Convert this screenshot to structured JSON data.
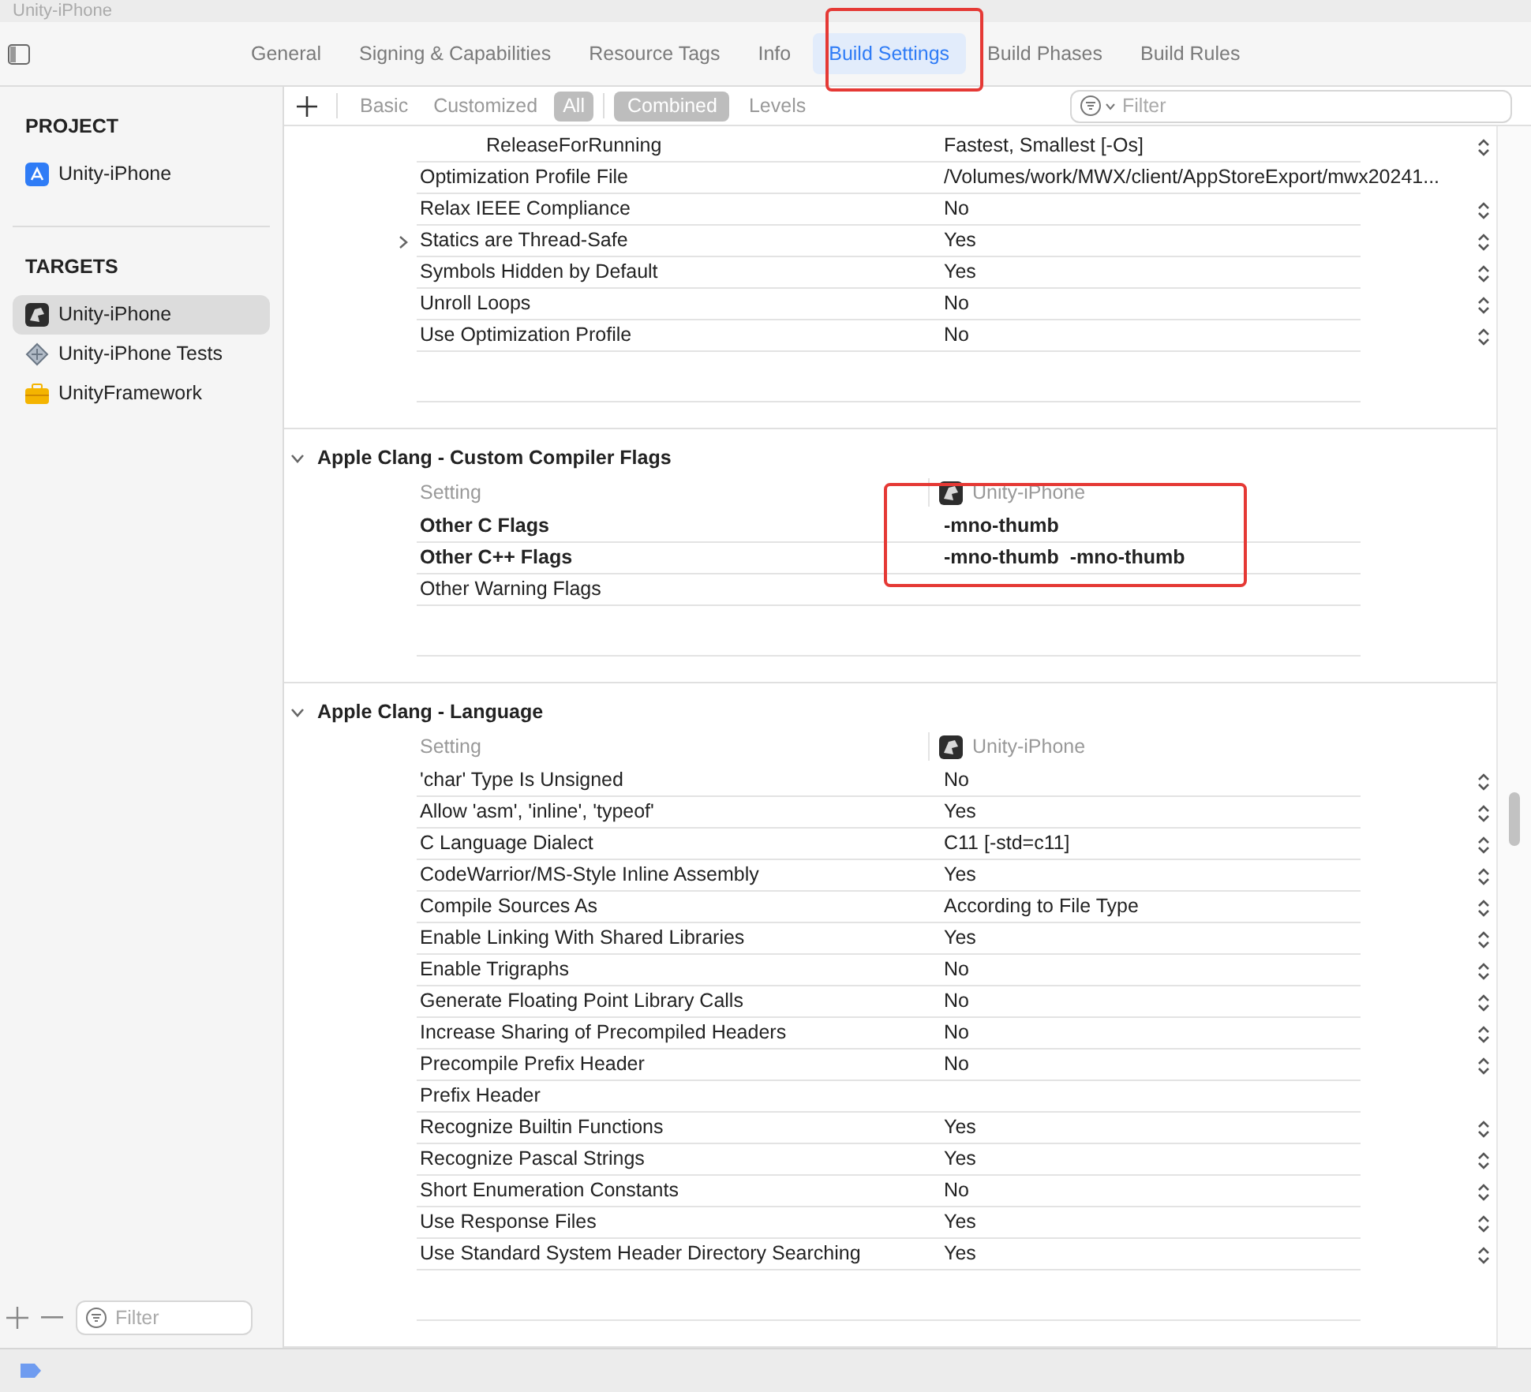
{
  "window": {
    "title": "Unity-iPhone"
  },
  "tabs": [
    {
      "label": "General",
      "selected": false
    },
    {
      "label": "Signing & Capabilities",
      "selected": false
    },
    {
      "label": "Resource Tags",
      "selected": false
    },
    {
      "label": "Info",
      "selected": false
    },
    {
      "label": "Build Settings",
      "selected": true
    },
    {
      "label": "Build Phases",
      "selected": false
    },
    {
      "label": "Build Rules",
      "selected": false
    }
  ],
  "sidebar": {
    "sections": [
      {
        "title": "PROJECT",
        "items": [
          {
            "label": "Unity-iPhone",
            "kind": "project",
            "selected": false
          }
        ]
      },
      {
        "title": "TARGETS",
        "items": [
          {
            "label": "Unity-iPhone",
            "kind": "app",
            "selected": true
          },
          {
            "label": "Unity-iPhone Tests",
            "kind": "tests",
            "selected": false
          },
          {
            "label": "UnityFramework",
            "kind": "framework",
            "selected": false
          }
        ]
      }
    ],
    "filter": {
      "placeholder": "Filter"
    }
  },
  "toolbar": {
    "scopes": [
      {
        "label": "Basic",
        "selected": false
      },
      {
        "label": "Customized",
        "selected": false
      },
      {
        "label": "All",
        "selected": true
      }
    ],
    "views": [
      {
        "label": "Combined",
        "selected": true
      },
      {
        "label": "Levels",
        "selected": false
      }
    ],
    "filter": {
      "placeholder": "Filter"
    }
  },
  "sections": [
    {
      "rows": [
        {
          "setting": "ReleaseForRunning",
          "value": "Fastest, Smallest [-Os]",
          "sub": true,
          "popup": true,
          "bold": false,
          "expandable": false
        },
        {
          "setting": "Optimization Profile File",
          "value": "/Volumes/work/MWX/client/AppStoreExport/mwx20241...",
          "sub": false,
          "popup": false,
          "bold": false,
          "expandable": false
        },
        {
          "setting": "Relax IEEE Compliance",
          "value": "No",
          "sub": false,
          "popup": true,
          "bold": false,
          "expandable": false
        },
        {
          "setting": "Statics are Thread-Safe",
          "value": "Yes",
          "sub": false,
          "popup": true,
          "bold": false,
          "expandable": true
        },
        {
          "setting": "Symbols Hidden by Default",
          "value": "Yes",
          "sub": false,
          "popup": true,
          "bold": false,
          "expandable": false
        },
        {
          "setting": "Unroll Loops",
          "value": "No",
          "sub": false,
          "popup": true,
          "bold": false,
          "expandable": false
        },
        {
          "setting": "Use Optimization Profile",
          "value": "No",
          "sub": false,
          "popup": true,
          "bold": false,
          "expandable": false
        }
      ]
    },
    {
      "title": "Apple Clang - Custom Compiler Flags",
      "expanded": true,
      "column_setting": "Setting",
      "column_target": "Unity-iPhone",
      "rows": [
        {
          "setting": "Other C Flags",
          "value": "-mno-thumb",
          "sub": false,
          "popup": false,
          "bold": true,
          "expandable": false
        },
        {
          "setting": "Other C++ Flags",
          "value": "-mno-thumb  -mno-thumb",
          "sub": false,
          "popup": false,
          "bold": true,
          "expandable": false
        },
        {
          "setting": "Other Warning Flags",
          "value": "",
          "sub": false,
          "popup": false,
          "bold": false,
          "expandable": false
        }
      ]
    },
    {
      "title": "Apple Clang - Language",
      "expanded": true,
      "column_setting": "Setting",
      "column_target": "Unity-iPhone",
      "rows": [
        {
          "setting": "'char' Type Is Unsigned",
          "value": "No",
          "sub": false,
          "popup": true,
          "bold": false,
          "expandable": false
        },
        {
          "setting": "Allow 'asm', 'inline', 'typeof'",
          "value": "Yes",
          "sub": false,
          "popup": true,
          "bold": false,
          "expandable": false
        },
        {
          "setting": "C Language Dialect",
          "value": "C11 [-std=c11]",
          "sub": false,
          "popup": true,
          "bold": false,
          "expandable": false
        },
        {
          "setting": "CodeWarrior/MS-Style Inline Assembly",
          "value": "Yes",
          "sub": false,
          "popup": true,
          "bold": false,
          "expandable": false
        },
        {
          "setting": "Compile Sources As",
          "value": "According to File Type",
          "sub": false,
          "popup": true,
          "bold": false,
          "expandable": false
        },
        {
          "setting": "Enable Linking With Shared Libraries",
          "value": "Yes",
          "sub": false,
          "popup": true,
          "bold": false,
          "expandable": false
        },
        {
          "setting": "Enable Trigraphs",
          "value": "No",
          "sub": false,
          "popup": true,
          "bold": false,
          "expandable": false
        },
        {
          "setting": "Generate Floating Point Library Calls",
          "value": "No",
          "sub": false,
          "popup": true,
          "bold": false,
          "expandable": false
        },
        {
          "setting": "Increase Sharing of Precompiled Headers",
          "value": "No",
          "sub": false,
          "popup": true,
          "bold": false,
          "expandable": false
        },
        {
          "setting": "Precompile Prefix Header",
          "value": "No",
          "sub": false,
          "popup": true,
          "bold": false,
          "expandable": false
        },
        {
          "setting": "Prefix Header",
          "value": "",
          "sub": false,
          "popup": false,
          "bold": false,
          "expandable": false
        },
        {
          "setting": "Recognize Builtin Functions",
          "value": "Yes",
          "sub": false,
          "popup": true,
          "bold": false,
          "expandable": false
        },
        {
          "setting": "Recognize Pascal Strings",
          "value": "Yes",
          "sub": false,
          "popup": true,
          "bold": false,
          "expandable": false
        },
        {
          "setting": "Short Enumeration Constants",
          "value": "No",
          "sub": false,
          "popup": true,
          "bold": false,
          "expandable": false
        },
        {
          "setting": "Use Response Files",
          "value": "Yes",
          "sub": false,
          "popup": true,
          "bold": false,
          "expandable": false
        },
        {
          "setting": "Use Standard System Header Directory Searching",
          "value": "Yes",
          "sub": false,
          "popup": true,
          "bold": false,
          "expandable": false
        }
      ]
    }
  ]
}
